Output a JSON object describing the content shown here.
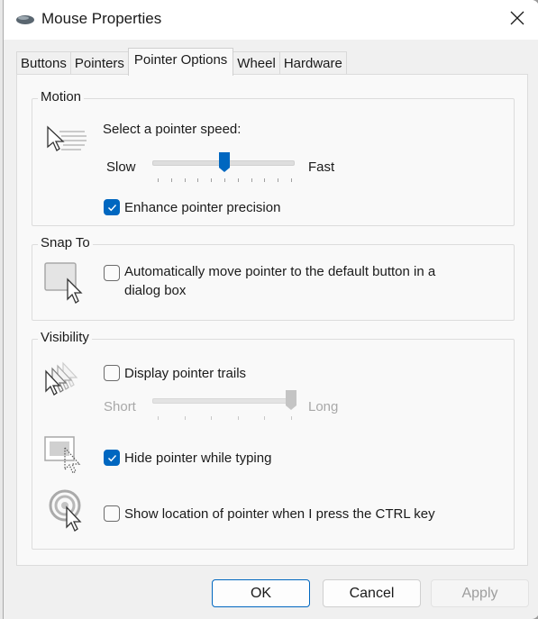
{
  "window": {
    "title": "Mouse Properties",
    "icon": "mouse-icon",
    "close_icon": "close-icon"
  },
  "tabs": [
    {
      "label": "Buttons",
      "active": false
    },
    {
      "label": "Pointers",
      "active": false
    },
    {
      "label": "Pointer Options",
      "active": true
    },
    {
      "label": "Wheel",
      "active": false
    },
    {
      "label": "Hardware",
      "active": false
    }
  ],
  "motion": {
    "group_label": "Motion",
    "icon": "pointer-speed-icon",
    "speed_label": "Select a pointer speed:",
    "slow_label": "Slow",
    "fast_label": "Fast",
    "speed_value": 5,
    "speed_max": 10,
    "enhance_precision": {
      "label": "Enhance pointer precision",
      "checked": true
    }
  },
  "snap_to": {
    "group_label": "Snap To",
    "icon": "snap-to-button-icon",
    "auto_move": {
      "label_line1": "Automatically move pointer to the default button in a",
      "label_line2": "dialog box",
      "checked": false
    }
  },
  "visibility": {
    "group_label": "Visibility",
    "trails_icon": "pointer-trails-icon",
    "trails": {
      "label": "Display pointer trails",
      "checked": false
    },
    "short_label": "Short",
    "long_label": "Long",
    "trails_value": 5,
    "trails_max": 5,
    "hide_icon": "hide-pointer-icon",
    "hide_while_typing": {
      "label": "Hide pointer while typing",
      "checked": true
    },
    "ctrl_icon": "pointer-location-icon",
    "show_location": {
      "label": "Show location of pointer when I press the CTRL key",
      "checked": false
    }
  },
  "buttons": {
    "ok": "OK",
    "cancel": "Cancel",
    "apply": "Apply"
  },
  "colors": {
    "accent": "#0067c0"
  }
}
